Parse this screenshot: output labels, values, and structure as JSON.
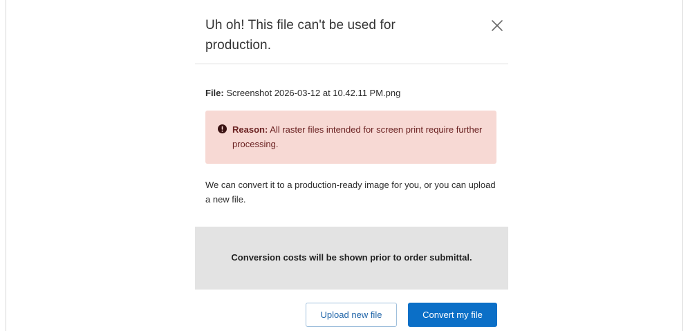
{
  "modal": {
    "title": "Uh oh! This file can't be used for production.",
    "close_icon": "close-icon"
  },
  "file": {
    "label": "File:",
    "name": "Screenshot 2026-03-12 at 10.42.11 PM.png"
  },
  "alert": {
    "icon": "exclamation-circle-icon",
    "reason_label": "Reason:",
    "reason_text": "All raster files intended for screen print require further processing.",
    "colors": {
      "background": "#f7d9d4",
      "text": "#6b2222"
    }
  },
  "body": {
    "message": "We can convert it to a production-ready image for you, or you can upload a new file."
  },
  "cost_notice": {
    "text": "Conversion costs will be shown prior to order submittal."
  },
  "actions": {
    "upload_label": "Upload new file",
    "convert_label": "Convert my file",
    "colors": {
      "primary": "#0b6fc7",
      "secondary_border": "#9fbfdc"
    }
  }
}
